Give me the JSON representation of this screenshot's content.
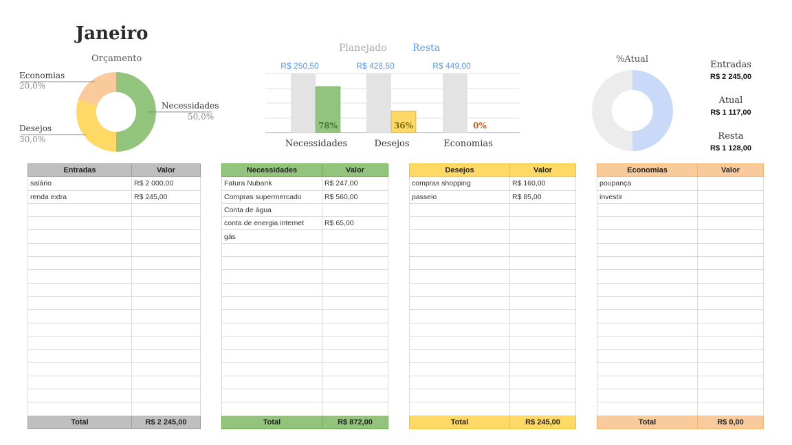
{
  "title": "Janeiro",
  "budget_donut": {
    "title": "Orçamento",
    "segments": [
      {
        "label": "Necessidades",
        "pct": "50,0%",
        "value": 50.0,
        "color": "#93c47d"
      },
      {
        "label": "Desejos",
        "pct": "30,0%",
        "value": 30.0,
        "color": "#ffd966"
      },
      {
        "label": "Economias",
        "pct": "20,0%",
        "value": 20.0,
        "color": "#f9cb9c"
      }
    ]
  },
  "bar_chart": {
    "legend_planned": "Planejado",
    "legend_remaining": "Resta",
    "groups": [
      {
        "category": "Necessidades",
        "remaining_label": "R$ 250,50",
        "percent_label": "78%",
        "percent": 78,
        "color": "#93c47d",
        "text_color": "#4a7a32"
      },
      {
        "category": "Desejos",
        "remaining_label": "R$ 428,50",
        "percent_label": "36%",
        "percent": 36,
        "color": "#ffd966",
        "text_color": "#7a6a10"
      },
      {
        "category": "Economias",
        "remaining_label": "R$ 449,00",
        "percent_label": "0%",
        "percent": 0,
        "color": "#f9cb9c",
        "text_color": "#c0652a"
      }
    ],
    "planned_color": "#e3e3e3"
  },
  "current_donut": {
    "title": "%Atual",
    "current_fraction": 0.5,
    "filled_color": "#c9daf8",
    "empty_color": "#ececec"
  },
  "summary": {
    "entradas_label": "Entradas",
    "entradas_value": "R$ 2 245,00",
    "atual_label": "Atual",
    "atual_value": "R$ 1 117,00",
    "resta_label": "Resta",
    "resta_value": "R$ 1 128,00"
  },
  "tables": {
    "entradas": {
      "header": [
        "Entradas",
        "Valor"
      ],
      "rows": [
        [
          "salário",
          "R$ 2 000,00"
        ],
        [
          "renda extra",
          "R$ 245,00"
        ]
      ],
      "total": [
        "Total",
        "R$ 2 245,00"
      ]
    },
    "necessidades": {
      "header": [
        "Necessidades",
        "Valor"
      ],
      "rows": [
        [
          "Fatura Nubank",
          "R$ 247,00"
        ],
        [
          "Compras supermercado",
          "R$ 560,00"
        ],
        [
          "Conta de água",
          ""
        ],
        [
          "conta de energia internet",
          "R$ 65,00"
        ],
        [
          "gás",
          ""
        ]
      ],
      "total": [
        "Total",
        "R$ 872,00"
      ]
    },
    "desejos": {
      "header": [
        "Desejos",
        "Valor"
      ],
      "rows": [
        [
          "compras shopping",
          "R$ 160,00"
        ],
        [
          "passeio",
          "R$ 85,00"
        ]
      ],
      "total": [
        "Total",
        "R$ 245,00"
      ]
    },
    "economias": {
      "header": [
        "Economias",
        "Valor"
      ],
      "rows": [
        [
          "poupança",
          ""
        ],
        [
          "investir",
          ""
        ]
      ],
      "total": [
        "Total",
        "R$ 0,00"
      ]
    }
  }
}
